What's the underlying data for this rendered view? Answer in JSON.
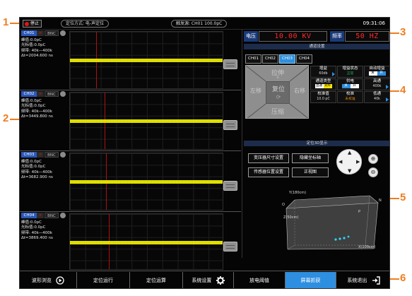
{
  "callouts": {
    "c1": "1",
    "c2": "2",
    "c3": "3",
    "c4": "4",
    "c5": "5",
    "c6": "6"
  },
  "top": {
    "stop_label": "停止",
    "mode_pill": "定位方式: 电-声定位",
    "trigger_pill": "触发源: CH01 100.0pC",
    "clock": "09:31:06"
  },
  "channels": [
    {
      "name": "CH01",
      "x": "×",
      "bnc": "BNC",
      "peak": "峰值:0.0pC",
      "cursor": "光标值:0.0pC",
      "freq": "频带: 40k—400k",
      "dt": "Δt=2004.600 ns"
    },
    {
      "name": "CH02",
      "x": "×",
      "bnc": "BNC",
      "peak": "峰值:0.0pC",
      "cursor": "光标值:0.0pC",
      "freq": "频带: 40k—400k",
      "dt": "Δt=3449.800 ns"
    },
    {
      "name": "CH03",
      "x": "×",
      "bnc": "BNC",
      "peak": "峰值:0.0pC",
      "cursor": "光标值:0.0pC",
      "freq": "频带: 40k—400k",
      "dt": "Δt=3682.900 ns"
    },
    {
      "name": "CH04",
      "x": "×",
      "bnc": "BNC",
      "peak": "峰值:0.0pC",
      "cursor": "光标值:0.0pC",
      "freq": "频带: 40k—400k",
      "dt": "Δt=3869.400 ns"
    }
  ],
  "panel": {
    "voltage_label": "电压",
    "voltage_value": "10.00 KV",
    "freq_label": "频率",
    "freq_value": "50 HZ",
    "channel_settings_title": "通道设置",
    "tabs": [
      "CH01",
      "CH02",
      "CH03",
      "CH04"
    ],
    "selected_tab": "CH03",
    "dpad": {
      "up": "拉伸",
      "left": "左移",
      "center": "复位",
      "right": "右移",
      "down": "压缩"
    },
    "params": {
      "gain_label": "增益",
      "gain_value": "60db",
      "gain_state_label": "增益状态",
      "gain_state_value": "正常",
      "auto_gain_label": "自动增益",
      "auto_gain_off": "关",
      "auto_gain_on": "开",
      "ch_type_label": "通道类型",
      "ch_type_a": "直通",
      "ch_type_b": "光纤",
      "discharge_label": "供电",
      "discharge_off": "关",
      "discharge_on": "开",
      "highpass_label": "高通",
      "highpass_value": "400k",
      "cal_value_label": "校准值",
      "cal_value": "10.0 pC",
      "cal_label": "校准",
      "cal_state": "未校准",
      "lowpass_label": "低通",
      "lowpass_value": "40k"
    },
    "positioning_title": "定位3D显示",
    "buttons": {
      "transformer_size": "变压器尺寸设置",
      "hide_axis": "隐藏坐标轴",
      "sensor_position": "传感器位置设置",
      "front_view": "正视图"
    },
    "view3d": {
      "y_label": "Y(180cm)",
      "z_label": "Z(50cm)",
      "x_label": "X(100cm)",
      "corner_o": "O",
      "corner_n": "N",
      "corner_p": "P"
    }
  },
  "bottom": {
    "waveform_browse": "波形浏览",
    "locate_run": "定位运行",
    "locate_calc": "定位运算",
    "system_settings": "系统设置",
    "discharge_threshold": "放电阈值",
    "screen_capture": "屏幕抓获",
    "system_exit": "系统退出"
  },
  "colors": {
    "accent": "#2e8fe0",
    "alert": "#d8141c",
    "trace": "#e6e600",
    "callout": "#f07d1e",
    "lcd_red": "#ff2a2a"
  }
}
